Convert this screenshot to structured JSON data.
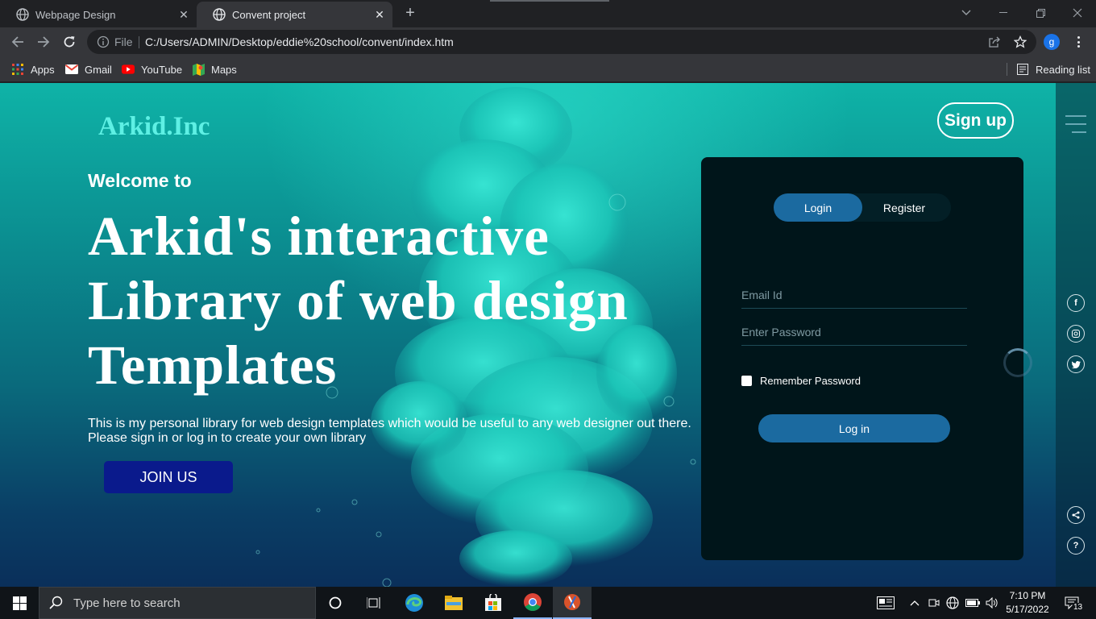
{
  "browser": {
    "tabs": [
      {
        "title": "Webpage Design",
        "active": false
      },
      {
        "title": "Convent project",
        "active": true
      }
    ],
    "omnibox": {
      "scheme_label": "File",
      "url": "C:/Users/ADMIN/Desktop/eddie%20school/convent/index.htm"
    },
    "profile_initial": "g",
    "bookmarks": [
      {
        "label": "Apps",
        "icon": "apps-grid-icon"
      },
      {
        "label": "Gmail",
        "icon": "gmail-icon"
      },
      {
        "label": "YouTube",
        "icon": "youtube-icon"
      },
      {
        "label": "Maps",
        "icon": "maps-icon"
      }
    ],
    "reading_list": "Reading list"
  },
  "page": {
    "brand": "Arkid.Inc",
    "signup_label": "Sign up",
    "welcome": "Welcome to",
    "headline_lines": [
      "Arkid's interactive",
      "Library of web design",
      "Templates"
    ],
    "description_lines": [
      "This is my personal library for web design templates which would be useful to any web designer out there.",
      "Please sign in or log in to create your own library"
    ],
    "join_label": "JOIN US",
    "login_panel": {
      "tab_login": "Login",
      "tab_register": "Register",
      "email_placeholder": "Email Id",
      "password_placeholder": "Enter Password",
      "remember_label": "Remember Password",
      "submit_label": "Log in"
    },
    "social": [
      {
        "name": "facebook-icon",
        "glyph": "f"
      },
      {
        "name": "instagram-icon",
        "glyph": "◎"
      },
      {
        "name": "twitter-icon",
        "glyph": "🐦"
      }
    ],
    "share_glyph": "<",
    "help_glyph": "?"
  },
  "taskbar": {
    "search_placeholder": "Type here to search",
    "clock_time": "7:10 PM",
    "clock_date": "5/17/2022",
    "notification_count": "13"
  },
  "colors": {
    "brand_cyan": "#5ef0e4",
    "accent_blue": "#1b6aa0",
    "join_navy": "#0a1a8c",
    "panel_bg": "#00151a"
  }
}
